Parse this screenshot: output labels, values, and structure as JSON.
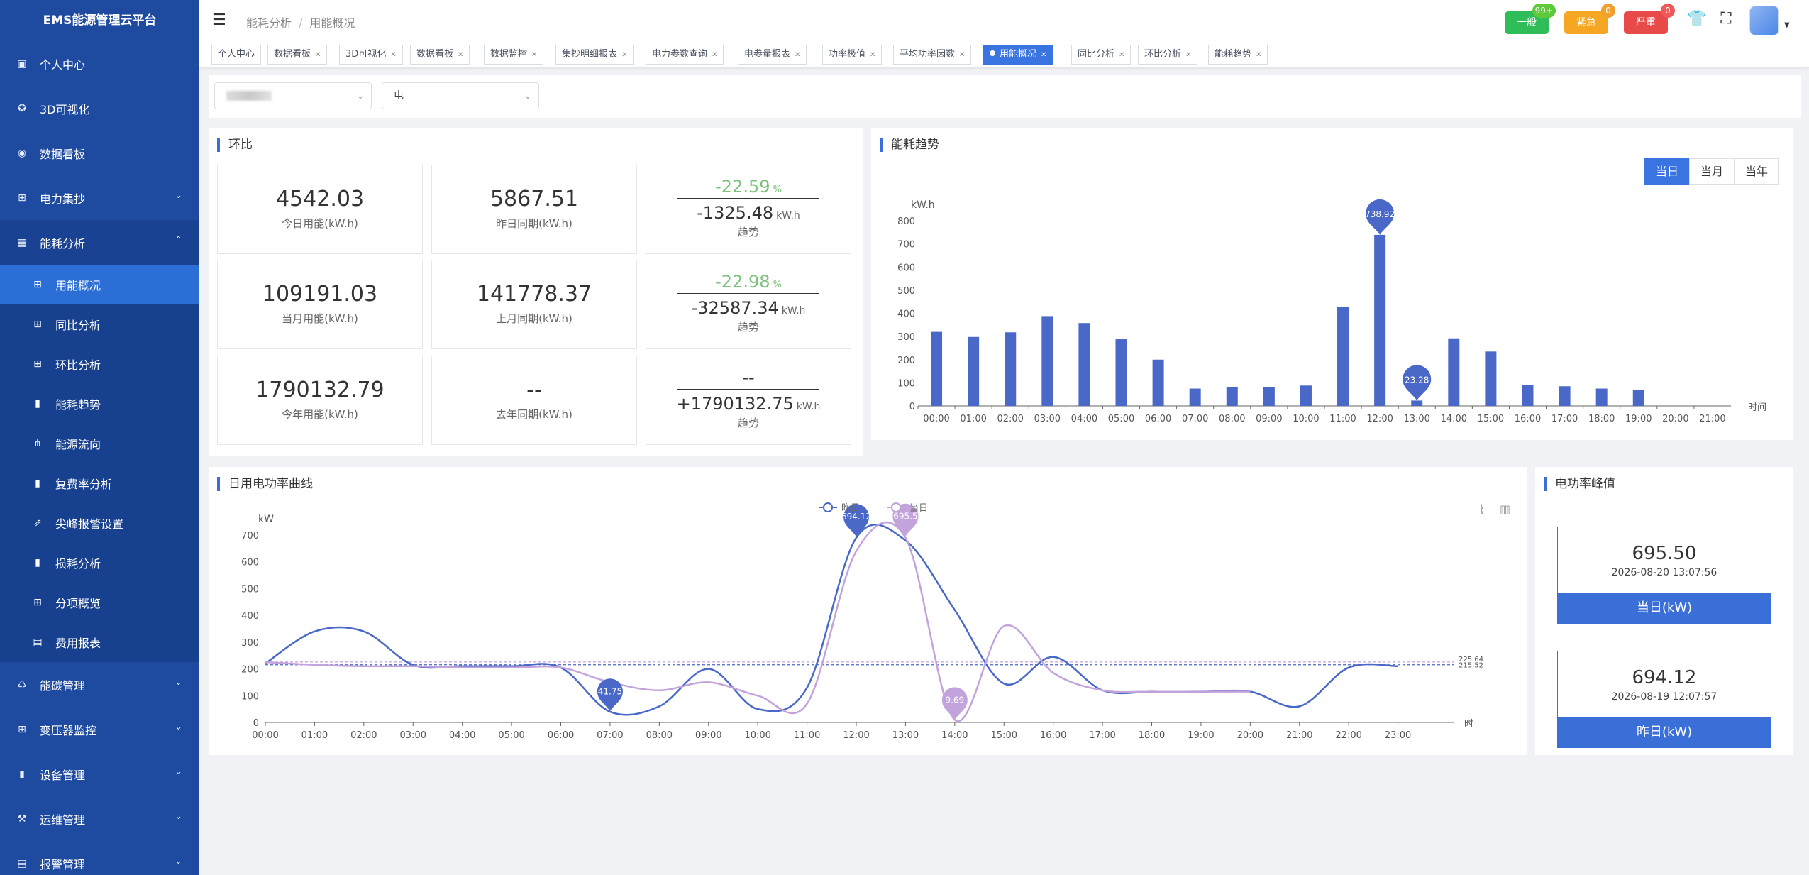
{
  "app": {
    "title": "EMS能源管理云平台"
  },
  "sidebar": {
    "items": [
      {
        "label": "个人中心",
        "icon": "profile-icon",
        "glyph": "▣"
      },
      {
        "label": "3D可视化",
        "icon": "globe-icon",
        "glyph": "✪"
      },
      {
        "label": "数据看板",
        "icon": "dashboard-icon",
        "glyph": "◉"
      },
      {
        "label": "电力集抄",
        "icon": "grid-icon",
        "glyph": "⊞",
        "chev": "⌄"
      },
      {
        "label": "能耗分析",
        "icon": "table-icon",
        "glyph": "▦",
        "chev": "⌃",
        "open": true,
        "children": [
          {
            "label": "用能概况",
            "icon": "table-icon",
            "glyph": "⊞",
            "active": true
          },
          {
            "label": "同比分析",
            "icon": "table-icon",
            "glyph": "⊞"
          },
          {
            "label": "环比分析",
            "icon": "table-icon",
            "glyph": "⊞"
          },
          {
            "label": "能耗趋势",
            "icon": "bar-chart-icon",
            "glyph": "▮"
          },
          {
            "label": "能源流向",
            "icon": "org-chart-icon",
            "glyph": "⋔"
          },
          {
            "label": "复费率分析",
            "icon": "bar-chart-icon",
            "glyph": "▮"
          },
          {
            "label": "尖峰报警设置",
            "icon": "external-link-icon",
            "glyph": "⇗"
          },
          {
            "label": "损耗分析",
            "icon": "bar-chart-icon",
            "glyph": "▮"
          },
          {
            "label": "分项概览",
            "icon": "grid-icon",
            "glyph": "⊞"
          },
          {
            "label": "费用报表",
            "icon": "document-icon",
            "glyph": "▤"
          }
        ]
      },
      {
        "label": "能碳管理",
        "icon": "recycle-icon",
        "glyph": "♺",
        "chev": "⌄"
      },
      {
        "label": "变压器监控",
        "icon": "grid-icon",
        "glyph": "⊞",
        "chev": "⌄"
      },
      {
        "label": "设备管理",
        "icon": "bar-chart-icon",
        "glyph": "▮",
        "chev": "⌄"
      },
      {
        "label": "运维管理",
        "icon": "tools-icon",
        "glyph": "⚒",
        "chev": "⌄"
      },
      {
        "label": "报警管理",
        "icon": "document-icon",
        "glyph": "▤",
        "chev": "⌄"
      }
    ]
  },
  "header": {
    "breadcrumb": [
      "能耗分析",
      "用能概况"
    ],
    "alerts": [
      {
        "label": "一般",
        "count": "99+",
        "color": "#2ebd59",
        "badge_color": "#5cc93a"
      },
      {
        "label": "紧急",
        "count": "0",
        "color": "#f5a623",
        "badge_color": "#f0a030"
      },
      {
        "label": "严重",
        "count": "0",
        "color": "#e84a4a",
        "badge_color": "#ee5a5a"
      }
    ]
  },
  "tabs": [
    {
      "label": "个人中心",
      "closable": false
    },
    {
      "label": "数据看板",
      "closable": true
    },
    {
      "label": "3D可视化",
      "closable": true
    },
    {
      "label": "数据看板",
      "closable": true
    },
    {
      "label": "数据监控",
      "closable": true
    },
    {
      "label": "集抄明细报表",
      "closable": true
    },
    {
      "label": "电力参数查询",
      "closable": true
    },
    {
      "label": "电参量报表",
      "closable": true
    },
    {
      "label": "功率极值",
      "closable": true
    },
    {
      "label": "平均功率因数",
      "closable": true
    },
    {
      "label": "用能概况",
      "closable": true,
      "active": true
    },
    {
      "label": "同比分析",
      "closable": true
    },
    {
      "label": "环比分析",
      "closable": true
    },
    {
      "label": "能耗趋势",
      "closable": true
    }
  ],
  "filters": {
    "energy_type": "电"
  },
  "huanbi": {
    "title": "环比",
    "rows": [
      {
        "cur_value": "4542.03",
        "cur_label": "今日用能(kW.h)",
        "prev_value": "5867.51",
        "prev_label": "昨日同期(kW.h)",
        "pct": "-22.59",
        "pct_unit": "%",
        "diff": "-1325.48",
        "diff_unit": "kW.h",
        "trend_label": "趋势"
      },
      {
        "cur_value": "109191.03",
        "cur_label": "当月用能(kW.h)",
        "prev_value": "141778.37",
        "prev_label": "上月同期(kW.h)",
        "pct": "-22.98",
        "pct_unit": "%",
        "diff": "-32587.34",
        "diff_unit": "kW.h",
        "trend_label": "趋势"
      },
      {
        "cur_value": "1790132.79",
        "cur_label": "今年用能(kW.h)",
        "prev_value": "--",
        "prev_label": "去年同期(kW.h)",
        "pct": "--",
        "pct_unit": "",
        "diff": "+1790132.75",
        "diff_unit": "kW.h",
        "trend_label": "趋势"
      }
    ]
  },
  "trend": {
    "title": "能耗趋势",
    "buttons": [
      "当日",
      "当月",
      "当年"
    ],
    "active_button": "当日"
  },
  "daily": {
    "title": "日用电功率曲线"
  },
  "peak": {
    "title": "电功率峰值",
    "today": {
      "value": "695.50",
      "time": "2026-08-20 13:07:56",
      "label": "当日(kW)"
    },
    "yesterday": {
      "value": "694.12",
      "time": "2026-08-19 12:07:57",
      "label": "昨日(kW)"
    }
  },
  "chart_data": [
    {
      "type": "bar",
      "ylabel": "kW.h",
      "xlabel": "时间",
      "ylim": [
        0,
        800
      ],
      "yticks": [
        0,
        100,
        200,
        300,
        400,
        500,
        600,
        700,
        800
      ],
      "color": "#4a68c8",
      "categories": [
        "00:00",
        "01:00",
        "02:00",
        "03:00",
        "04:00",
        "05:00",
        "06:00",
        "07:00",
        "08:00",
        "09:00",
        "10:00",
        "11:00",
        "12:00",
        "13:00",
        "14:00",
        "15:00",
        "16:00",
        "17:00",
        "18:00",
        "19:00",
        "20:00",
        "21:00"
      ],
      "values": [
        320,
        298,
        318,
        388,
        358,
        288,
        200,
        75,
        80,
        80,
        88,
        428,
        738.92,
        23.28,
        292,
        235,
        90,
        85,
        75,
        68,
        0,
        0
      ],
      "markers": [
        {
          "category": "12:00",
          "value": 738.92,
          "label": "738.92"
        },
        {
          "category": "13:00",
          "value": 23.28,
          "label": "23.28"
        }
      ]
    },
    {
      "type": "line",
      "ylabel": "kW",
      "xlabel": "时",
      "ylim": [
        0,
        700
      ],
      "yticks": [
        0,
        100,
        200,
        300,
        400,
        500,
        600,
        700
      ],
      "x": [
        "00:00",
        "01:00",
        "02:00",
        "03:00",
        "04:00",
        "05:00",
        "06:00",
        "07:00",
        "08:00",
        "09:00",
        "10:00",
        "11:00",
        "12:00",
        "13:00",
        "14:00",
        "15:00",
        "16:00",
        "17:00",
        "18:00",
        "19:00",
        "20:00",
        "21:00",
        "22:00",
        "23:00"
      ],
      "series": [
        {
          "name": "昨日",
          "color": "#4a68c8",
          "points": [
            [
              0,
              220
            ],
            [
              1,
              340
            ],
            [
              2,
              340
            ],
            [
              3,
              215
            ],
            [
              4,
              210
            ],
            [
              5,
              210
            ],
            [
              6,
              205
            ],
            [
              7,
              40
            ],
            [
              8,
              60
            ],
            [
              9,
              200
            ],
            [
              10,
              50
            ],
            [
              11,
              130
            ],
            [
              12,
              690
            ],
            [
              13,
              680
            ],
            [
              14,
              420
            ],
            [
              15,
              145
            ],
            [
              16,
              245
            ],
            [
              17,
              120
            ],
            [
              18,
              115
            ],
            [
              19,
              115
            ],
            [
              20,
              115
            ],
            [
              21,
              60
            ],
            [
              22,
              205
            ],
            [
              23,
              210
            ]
          ],
          "markers": [
            {
              "x": 7,
              "value": 41.75,
              "label": "41.75"
            },
            {
              "x": 12,
              "value": 694.12,
              "label": "694.12"
            }
          ],
          "avg": 215.52,
          "avg_label": "215.52"
        },
        {
          "name": "当日",
          "color": "#c3a3dc",
          "points": [
            [
              0,
              225
            ],
            [
              1,
              215
            ],
            [
              2,
              210
            ],
            [
              3,
              210
            ],
            [
              4,
              205
            ],
            [
              5,
              205
            ],
            [
              6,
              205
            ],
            [
              7,
              150
            ],
            [
              8,
              120
            ],
            [
              9,
              150
            ],
            [
              10,
              100
            ],
            [
              11,
              70
            ],
            [
              12,
              640
            ],
            [
              13,
              690
            ],
            [
              14,
              10
            ],
            [
              15,
              360
            ],
            [
              16,
              185
            ],
            [
              17,
              120
            ],
            [
              18,
              115
            ],
            [
              19,
              115
            ],
            [
              20,
              115
            ]
          ],
          "markers": [
            {
              "x": 13,
              "value": 695.5,
              "label": "695.5"
            },
            {
              "x": 14,
              "value": 9.69,
              "label": "9.69"
            }
          ],
          "avg": 225.64,
          "avg_label": "225.64"
        }
      ]
    }
  ]
}
